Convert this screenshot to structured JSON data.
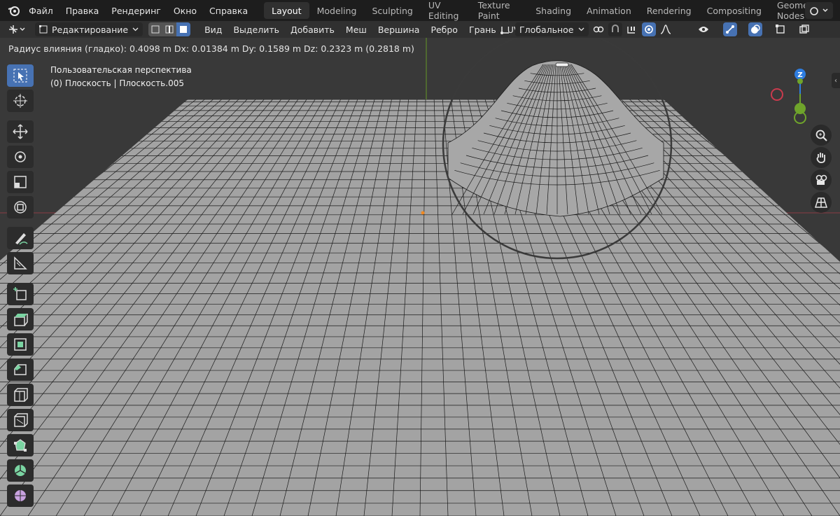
{
  "top_menu": {
    "items": [
      "Файл",
      "Правка",
      "Рендеринг",
      "Окно",
      "Справка"
    ]
  },
  "workspaces": {
    "tabs": [
      "Layout",
      "Modeling",
      "Sculpting",
      "UV Editing",
      "Texture Paint",
      "Shading",
      "Animation",
      "Rendering",
      "Compositing",
      "Geometry Nodes"
    ],
    "active": "Layout"
  },
  "header": {
    "mode": "Редактирование",
    "menus": [
      "Вид",
      "Выделить",
      "Добавить",
      "Меш",
      "Вершина",
      "Ребро",
      "Грань",
      "UV"
    ],
    "orientation": "Глобальное"
  },
  "viewport": {
    "status": "Радиус влияния (гладко): 0.4098 m   Dx: 0.01384 m   Dy: 0.1589 m   Dz: 0.2323 m (0.2818 m)",
    "perspective": "Пользовательская перспектива",
    "object": "(0) Плоскость | Плоскость.005",
    "gizmo_label": "Z"
  },
  "colors": {
    "accent": "#4772b3",
    "viewport_bg": "#393939",
    "mesh_face": "#a3a3a3",
    "wire": "#1a1a1a",
    "axis_x": "#c93a4d",
    "axis_y": "#6fa42b",
    "axis_z": "#2e7de0"
  }
}
